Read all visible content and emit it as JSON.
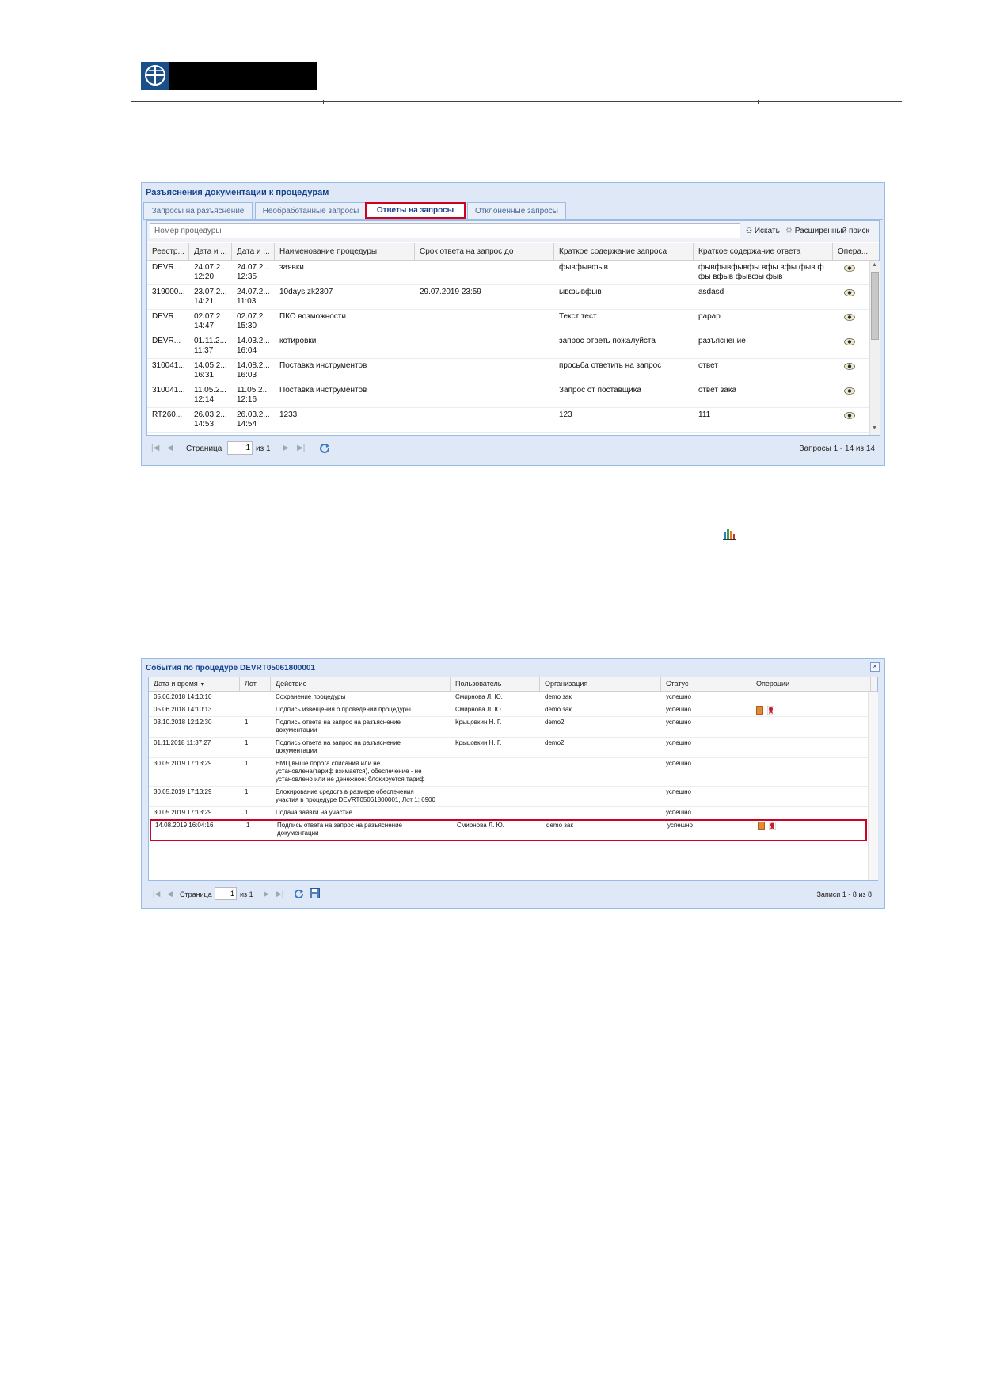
{
  "panel1": {
    "title": "Разъяснения документации к процедурам",
    "tabs": [
      "Запросы на разъяснение",
      "Необработанные запросы",
      "Ответы на запросы",
      "Отклоненные запросы"
    ],
    "active_tab": "Ответы на запросы",
    "search_placeholder": "Номер процедуры",
    "search_button": "Искать",
    "advanced_search": "Расширенный поиск",
    "columns": [
      "Реестр...",
      "Дата и ...",
      "Дата и ...",
      "Наименование процедуры",
      "Срок ответа на запрос до",
      "Краткое содержание запроса",
      "Краткое содержание ответа",
      "Опера..."
    ],
    "rows": [
      {
        "reg": "DEVR...",
        "d1": "24.07.2...\n12:20",
        "d2": "24.07.2...\n12:35",
        "name": "заявки",
        "deadline": "",
        "request": "фывфывфыв",
        "answer": "фывфывфывфы вфы вфы фыв ф\nфы вфыв фывфы фыв"
      },
      {
        "reg": "319000...",
        "d1": "23.07.2...\n14:21",
        "d2": "24.07.2...\n11:03",
        "name": "10days zk2307",
        "deadline": "29.07.2019 23:59",
        "request": "ывфывфыв",
        "answer": "asdasd"
      },
      {
        "reg": "DEVR",
        "d1": "02.07.2\n14:47",
        "d2": "02.07.2\n15:30",
        "name": "ПКО возможности",
        "deadline": "",
        "request": "Текст тест",
        "answer": "рарар"
      },
      {
        "reg": "DEVR...",
        "d1": "01.11.2...\n11:37",
        "d2": "14.03.2...\n16:04",
        "name": "котировки",
        "deadline": "",
        "request": "запрос ответь пожалуйста",
        "answer": "разъяснение"
      },
      {
        "reg": "310041...",
        "d1": "14.05.2...\n16:31",
        "d2": "14.08.2...\n16:03",
        "name": "Поставка инструментов",
        "deadline": "",
        "request": "просьба ответить на запрос",
        "answer": "ответ"
      },
      {
        "reg": "310041...",
        "d1": "11.05.2...\n12:14",
        "d2": "11.05.2...\n12:16",
        "name": "Поставка инструментов",
        "deadline": "",
        "request": "Запрос от поставщика",
        "answer": "ответ зака"
      },
      {
        "reg": "RT260...",
        "d1": "26.03.2...\n14:53",
        "d2": "26.03.2...\n14:54",
        "name": "1233",
        "deadline": "",
        "request": "123",
        "answer": "111"
      }
    ],
    "pager": {
      "page_label": "Страница",
      "page": "1",
      "of": "из 1",
      "summary": "Запросы 1 - 14 из 14"
    }
  },
  "panel2": {
    "title": "События по процедуре DEVRT05061800001",
    "columns": [
      "Дата и время",
      "Лот",
      "Действие",
      "Пользователь",
      "Организация",
      "Статус",
      "Операции"
    ],
    "rows": [
      {
        "dt": "05.06.2018 14:10:10",
        "lot": "",
        "action": "Сохранение процедуры",
        "user": "Смирнова Л. Ю.",
        "org": "demo зак",
        "status": "успешно",
        "ops": false
      },
      {
        "dt": "05.06.2018 14:10:13",
        "lot": "",
        "action": "Подпись извещения о проведении процедуры",
        "user": "Смирнова Л. Ю.",
        "org": "demo зак",
        "status": "успешно",
        "ops": true
      },
      {
        "dt": "03.10.2018 12:12:30",
        "lot": "1",
        "action": "Подпись ответа на запрос на разъяснение\nдокументации",
        "user": "Крыцовкин Н. Г.",
        "org": "demo2",
        "status": "успешно",
        "ops": false
      },
      {
        "dt": "01.11.2018 11:37:27",
        "lot": "1",
        "action": "Подпись ответа на запрос на разъяснение\nдокументации",
        "user": "Крыцовкин Н. Г.",
        "org": "demo2",
        "status": "успешно",
        "ops": false
      },
      {
        "dt": "30.05.2019 17:13:29",
        "lot": "1",
        "action": "НМЦ выше порога списания или не\nустановлена(тариф взимается), обеспечение - не\nустановлено или не денежное: блокируется тариф",
        "user": "",
        "org": "",
        "status": "успешно",
        "ops": false
      },
      {
        "dt": "30.05.2019 17:13:29",
        "lot": "1",
        "action": "Блокирование средств в размере обеспечения\nучастия в процедуре DEVRT05061800001, Лот 1: 6900",
        "user": "",
        "org": "",
        "status": "успешно",
        "ops": false
      },
      {
        "dt": "30.05.2019 17:13:29",
        "lot": "1",
        "action": "Подача заявки на участие",
        "user": "",
        "org": "",
        "status": "успешно",
        "ops": false
      },
      {
        "dt": "14.08.2019 16:04:16",
        "lot": "1",
        "action": "Подпись ответа на запрос на разъяснение\nдокументации",
        "user": "Смирнова Л. Ю.",
        "org": "demo зак",
        "status": "успешно",
        "ops": true
      }
    ],
    "pager": {
      "page_label": "Страница",
      "page": "1",
      "of": "из 1",
      "summary": "Записи 1 - 8 из 8"
    }
  },
  "colors": {
    "accent": "#15428b",
    "highlight": "#d00020",
    "panel_border": "#99bbe8"
  },
  "icons": [
    "logo-icon",
    "chart-icon",
    "eye-icon",
    "document-icon",
    "seal-icon",
    "refresh-icon",
    "save-icon",
    "close-icon"
  ]
}
